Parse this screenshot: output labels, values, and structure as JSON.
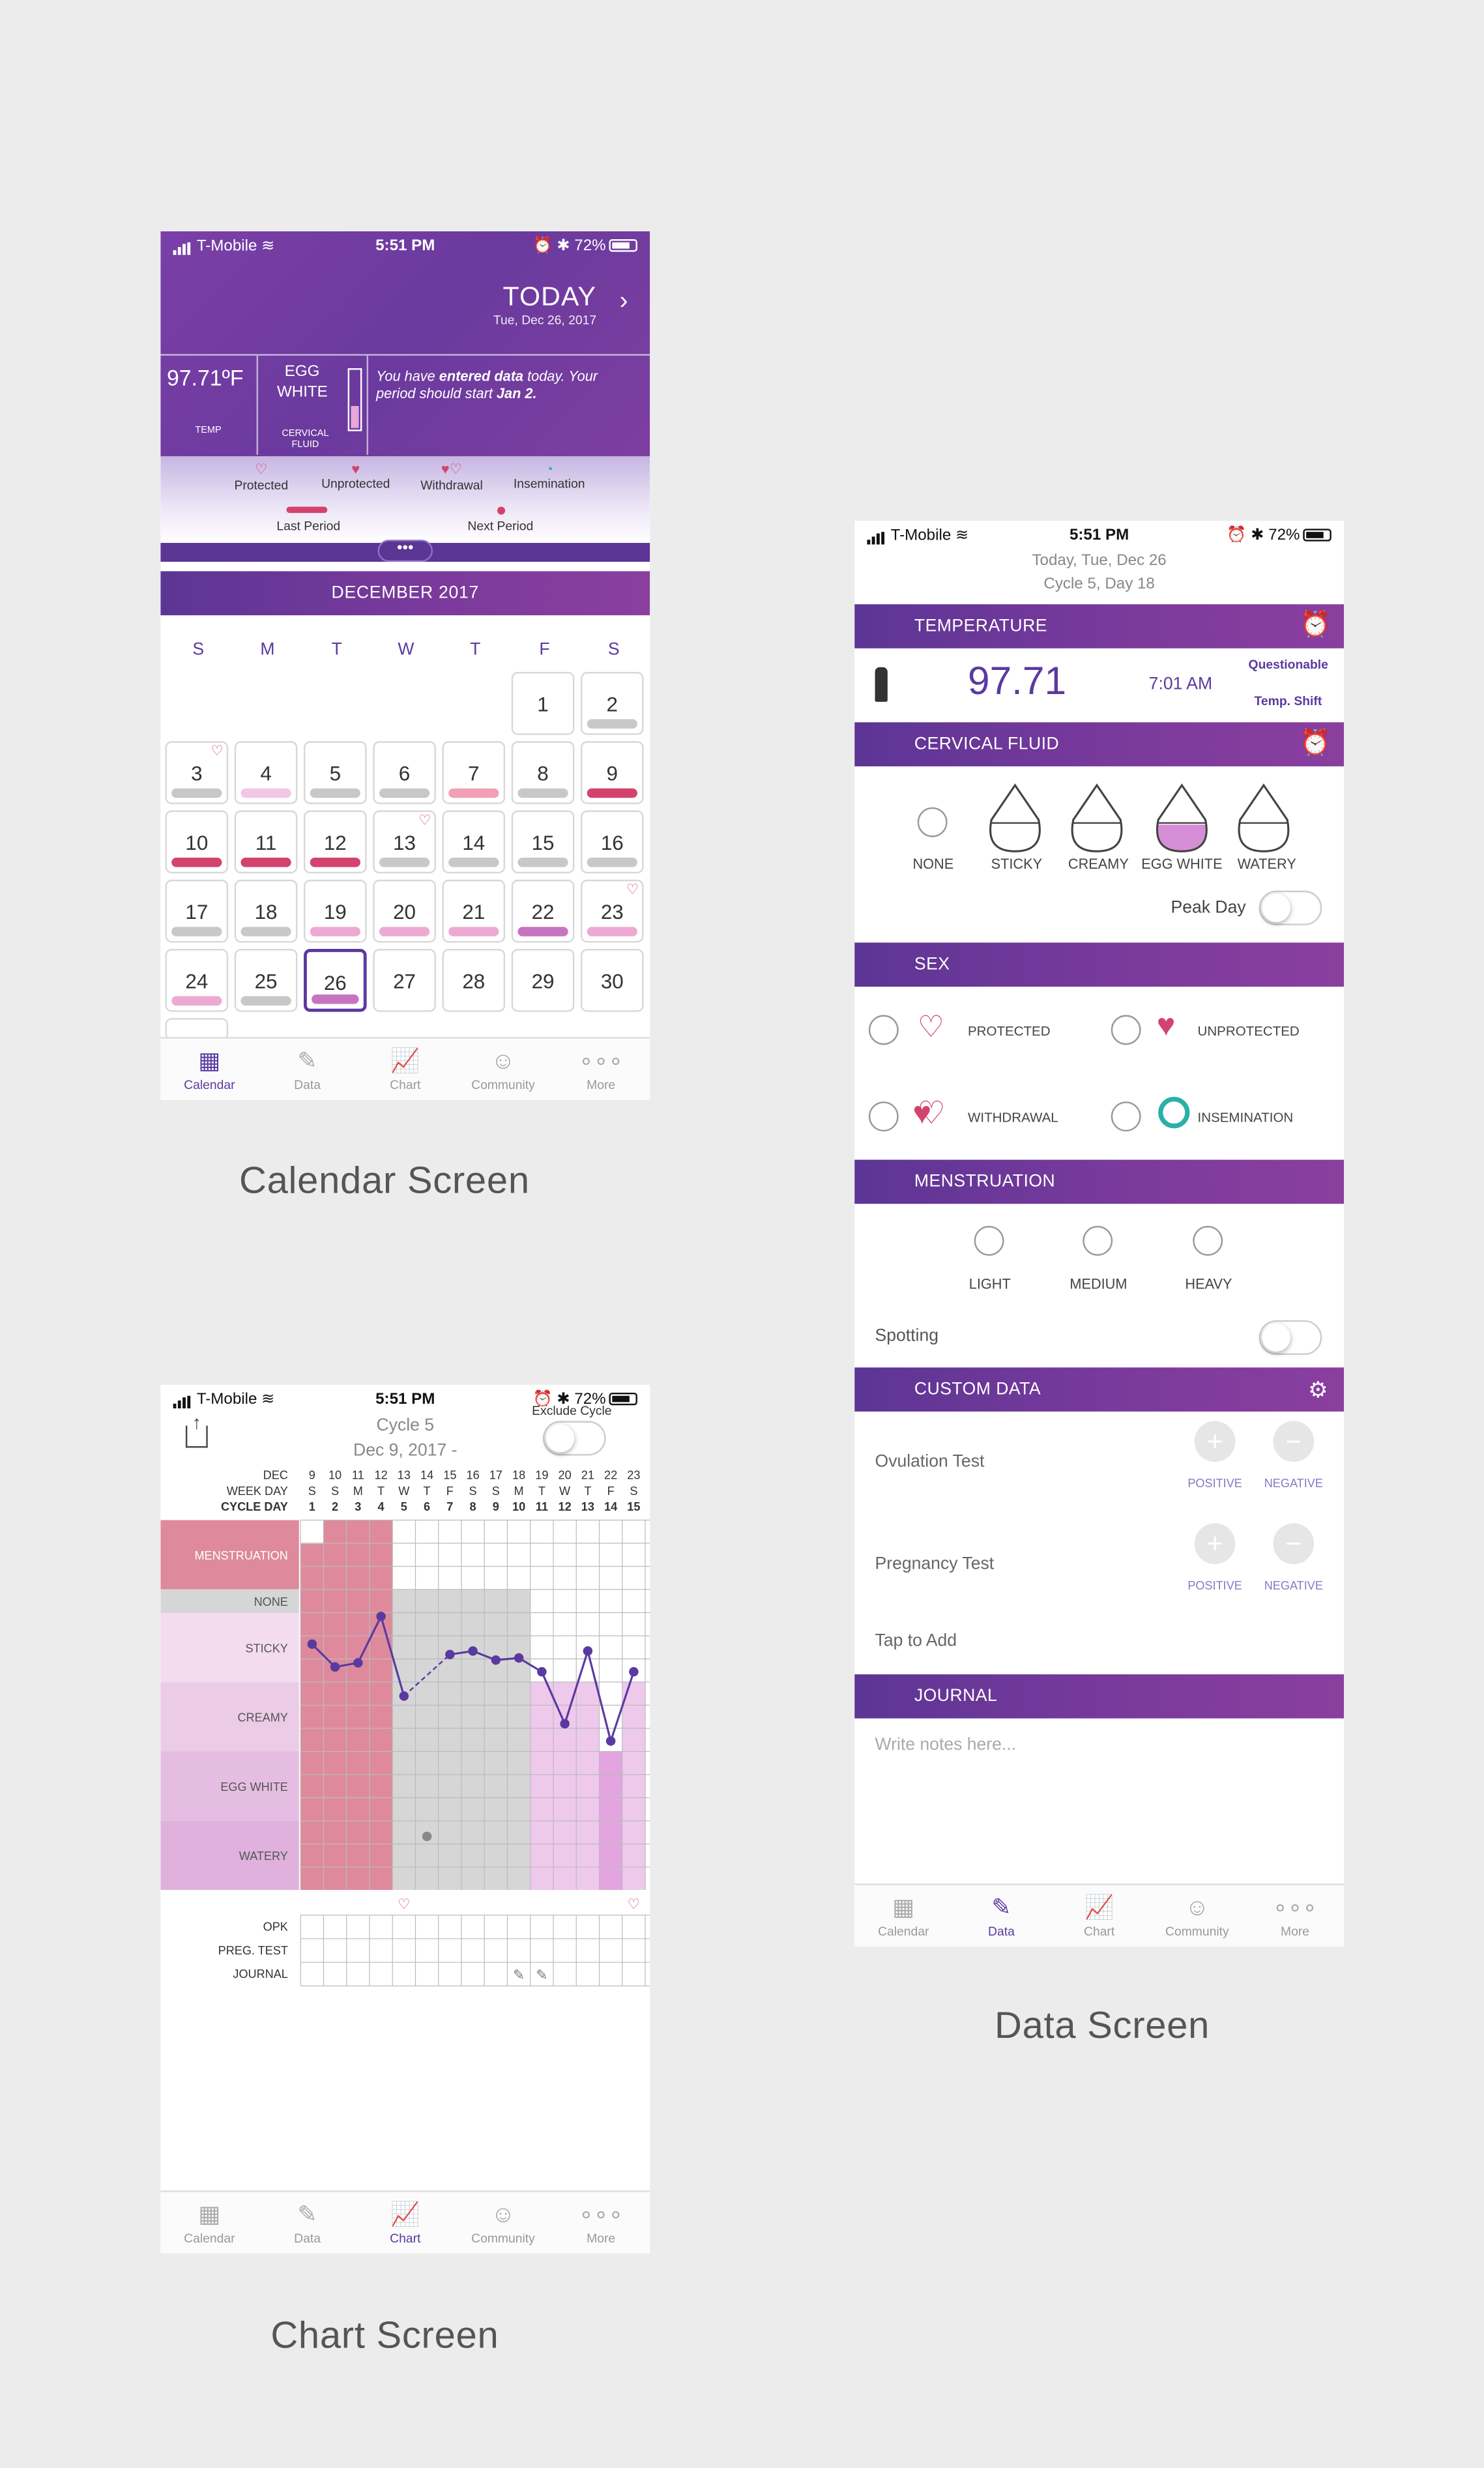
{
  "colors": {
    "primary": "#5c3595",
    "accent": "#8a3f9e",
    "period_dark": "#d3436d",
    "period_light": "#ecaad3",
    "fertile": "#c774c0",
    "none_gray": "#c8c8c8"
  },
  "status_bar": {
    "carrier": "T-Mobile",
    "time": "5:51 PM",
    "battery": "72%"
  },
  "captions": {
    "calendar": "Calendar Screen",
    "data": "Data Screen",
    "chart": "Chart Screen"
  },
  "tabs": [
    {
      "label": "Calendar",
      "icon": "calendar-icon"
    },
    {
      "label": "Data",
      "icon": "pencil-icon"
    },
    {
      "label": "Chart",
      "icon": "chart-icon"
    },
    {
      "label": "Community",
      "icon": "community-icon"
    },
    {
      "label": "More",
      "icon": "more-icon"
    }
  ],
  "calendar": {
    "today": "TODAY",
    "today_date": "Tue, Dec 26, 2017",
    "temp": "97.71ºF",
    "temp_label": "TEMP",
    "fluid": "EGG WHITE",
    "fluid_label": "CERVICAL FLUID",
    "message_pre": "You have ",
    "message_bold1": "entered data",
    "message_mid": " today. Your period should start ",
    "message_bold2": "Jan 2.",
    "legend": [
      "Protected",
      "Unprotected",
      "Withdrawal",
      "Insemination"
    ],
    "last_period": "Last Period",
    "next_period": "Next Period",
    "month": "DECEMBER 2017",
    "weekdays": [
      "S",
      "M",
      "T",
      "W",
      "T",
      "F",
      "S"
    ],
    "days": [
      "1",
      "2",
      "3",
      "4",
      "5",
      "6",
      "7",
      "8",
      "9",
      "10",
      "11",
      "12",
      "13",
      "14",
      "15",
      "16",
      "17",
      "18",
      "19",
      "20",
      "21",
      "22",
      "23",
      "24",
      "25",
      "26",
      "27",
      "28",
      "29",
      "30"
    ]
  },
  "data_screen": {
    "date": "Today, Tue, Dec 26",
    "cycle": "Cycle 5, Day 18",
    "temperature": {
      "title": "TEMPERATURE",
      "value": "97.71",
      "time": "7:01 AM",
      "flag1": "Questionable",
      "flag2": "Temp. Shift"
    },
    "cervical": {
      "title": "CERVICAL FLUID",
      "options": [
        "NONE",
        "STICKY",
        "CREAMY",
        "EGG WHITE",
        "WATERY"
      ],
      "peak": "Peak Day"
    },
    "sex": {
      "title": "SEX",
      "options": [
        "PROTECTED",
        "UNPROTECTED",
        "WITHDRAWAL",
        "INSEMINATION"
      ]
    },
    "menstruation": {
      "title": "MENSTRUATION",
      "options": [
        "LIGHT",
        "MEDIUM",
        "HEAVY"
      ],
      "spotting": "Spotting"
    },
    "custom": {
      "title": "CUSTOM DATA",
      "ovulation": "Ovulation Test",
      "pregnancy": "Pregnancy Test",
      "positive": "POSITIVE",
      "negative": "NEGATIVE",
      "tap": "Tap to Add"
    },
    "journal": {
      "title": "JOURNAL",
      "placeholder": "Write notes here..."
    }
  },
  "chart_screen": {
    "cycle": "Cycle 5",
    "date_range": "Dec 9, 2017 -",
    "exclude": "Exclude Cycle",
    "row_labels": {
      "dec": "DEC",
      "week": "WEEK DAY",
      "cycle": "CYCLE DAY"
    },
    "dates": [
      "9",
      "10",
      "11",
      "12",
      "13",
      "14",
      "15",
      "16",
      "17",
      "18",
      "19",
      "20",
      "21",
      "22",
      "23"
    ],
    "weekdays": [
      "S",
      "S",
      "M",
      "T",
      "W",
      "T",
      "F",
      "S",
      "S",
      "M",
      "T",
      "W",
      "T",
      "F",
      "S"
    ],
    "cycle_days": [
      "1",
      "2",
      "3",
      "4",
      "5",
      "6",
      "7",
      "8",
      "9",
      "10",
      "11",
      "12",
      "13",
      "14",
      "15"
    ],
    "categories": [
      "MENSTRUATION",
      "NONE",
      "STICKY",
      "CREAMY",
      "EGG WHITE",
      "WATERY"
    ],
    "bottom_rows": [
      "OPK",
      "PREG. TEST",
      "JOURNAL"
    ]
  },
  "chart_data": {
    "type": "line",
    "x": [
      "9",
      "10",
      "11",
      "12",
      "13",
      "14",
      "15",
      "16",
      "17",
      "18",
      "19",
      "20",
      "21",
      "22",
      "23"
    ],
    "y_categories": [
      "STICKY",
      "CREAMY",
      "EGG WHITE",
      "WATERY"
    ],
    "values": [
      0.45,
      0.78,
      0.72,
      0.05,
      1.2,
      null,
      0.6,
      0.55,
      0.68,
      0.65,
      0.85,
      1.6,
      0.55,
      1.85,
      0.85
    ]
  }
}
